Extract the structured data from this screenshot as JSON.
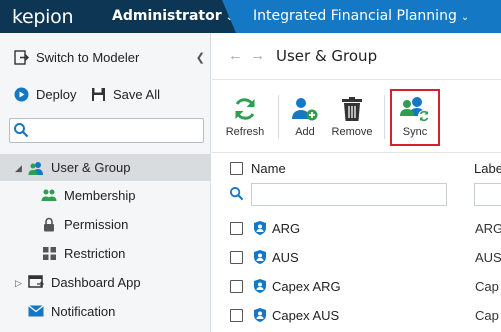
{
  "topbar": {
    "logo": "kepion",
    "role_label": "Administrator",
    "app_label": "Integrated Financial Planning"
  },
  "sidebar": {
    "switch_label": "Switch to Modeler",
    "deploy_label": "Deploy",
    "save_all_label": "Save All",
    "search_value": "",
    "tree": [
      {
        "label": "User & Group",
        "selected": true
      },
      {
        "label": "Membership"
      },
      {
        "label": "Permission"
      },
      {
        "label": "Restriction"
      },
      {
        "label": "Dashboard App"
      },
      {
        "label": "Notification"
      }
    ]
  },
  "breadcrumb": {
    "title": "User & Group"
  },
  "toolbar": {
    "refresh_label": "Refresh",
    "add_label": "Add",
    "remove_label": "Remove",
    "sync_label": "Sync"
  },
  "grid": {
    "columns": [
      "Name",
      "Labe"
    ],
    "rows": [
      {
        "name": "ARG",
        "label": "ARG"
      },
      {
        "name": "AUS",
        "label": "AUS"
      },
      {
        "name": "Capex ARG",
        "label": "Cap"
      },
      {
        "name": "Capex AUS",
        "label": "Cap"
      }
    ]
  },
  "colors": {
    "topbar": "#0d3554",
    "app_accent": "#1478c4",
    "refresh_green": "#2e9e4f",
    "highlight_red": "#d4212a"
  }
}
